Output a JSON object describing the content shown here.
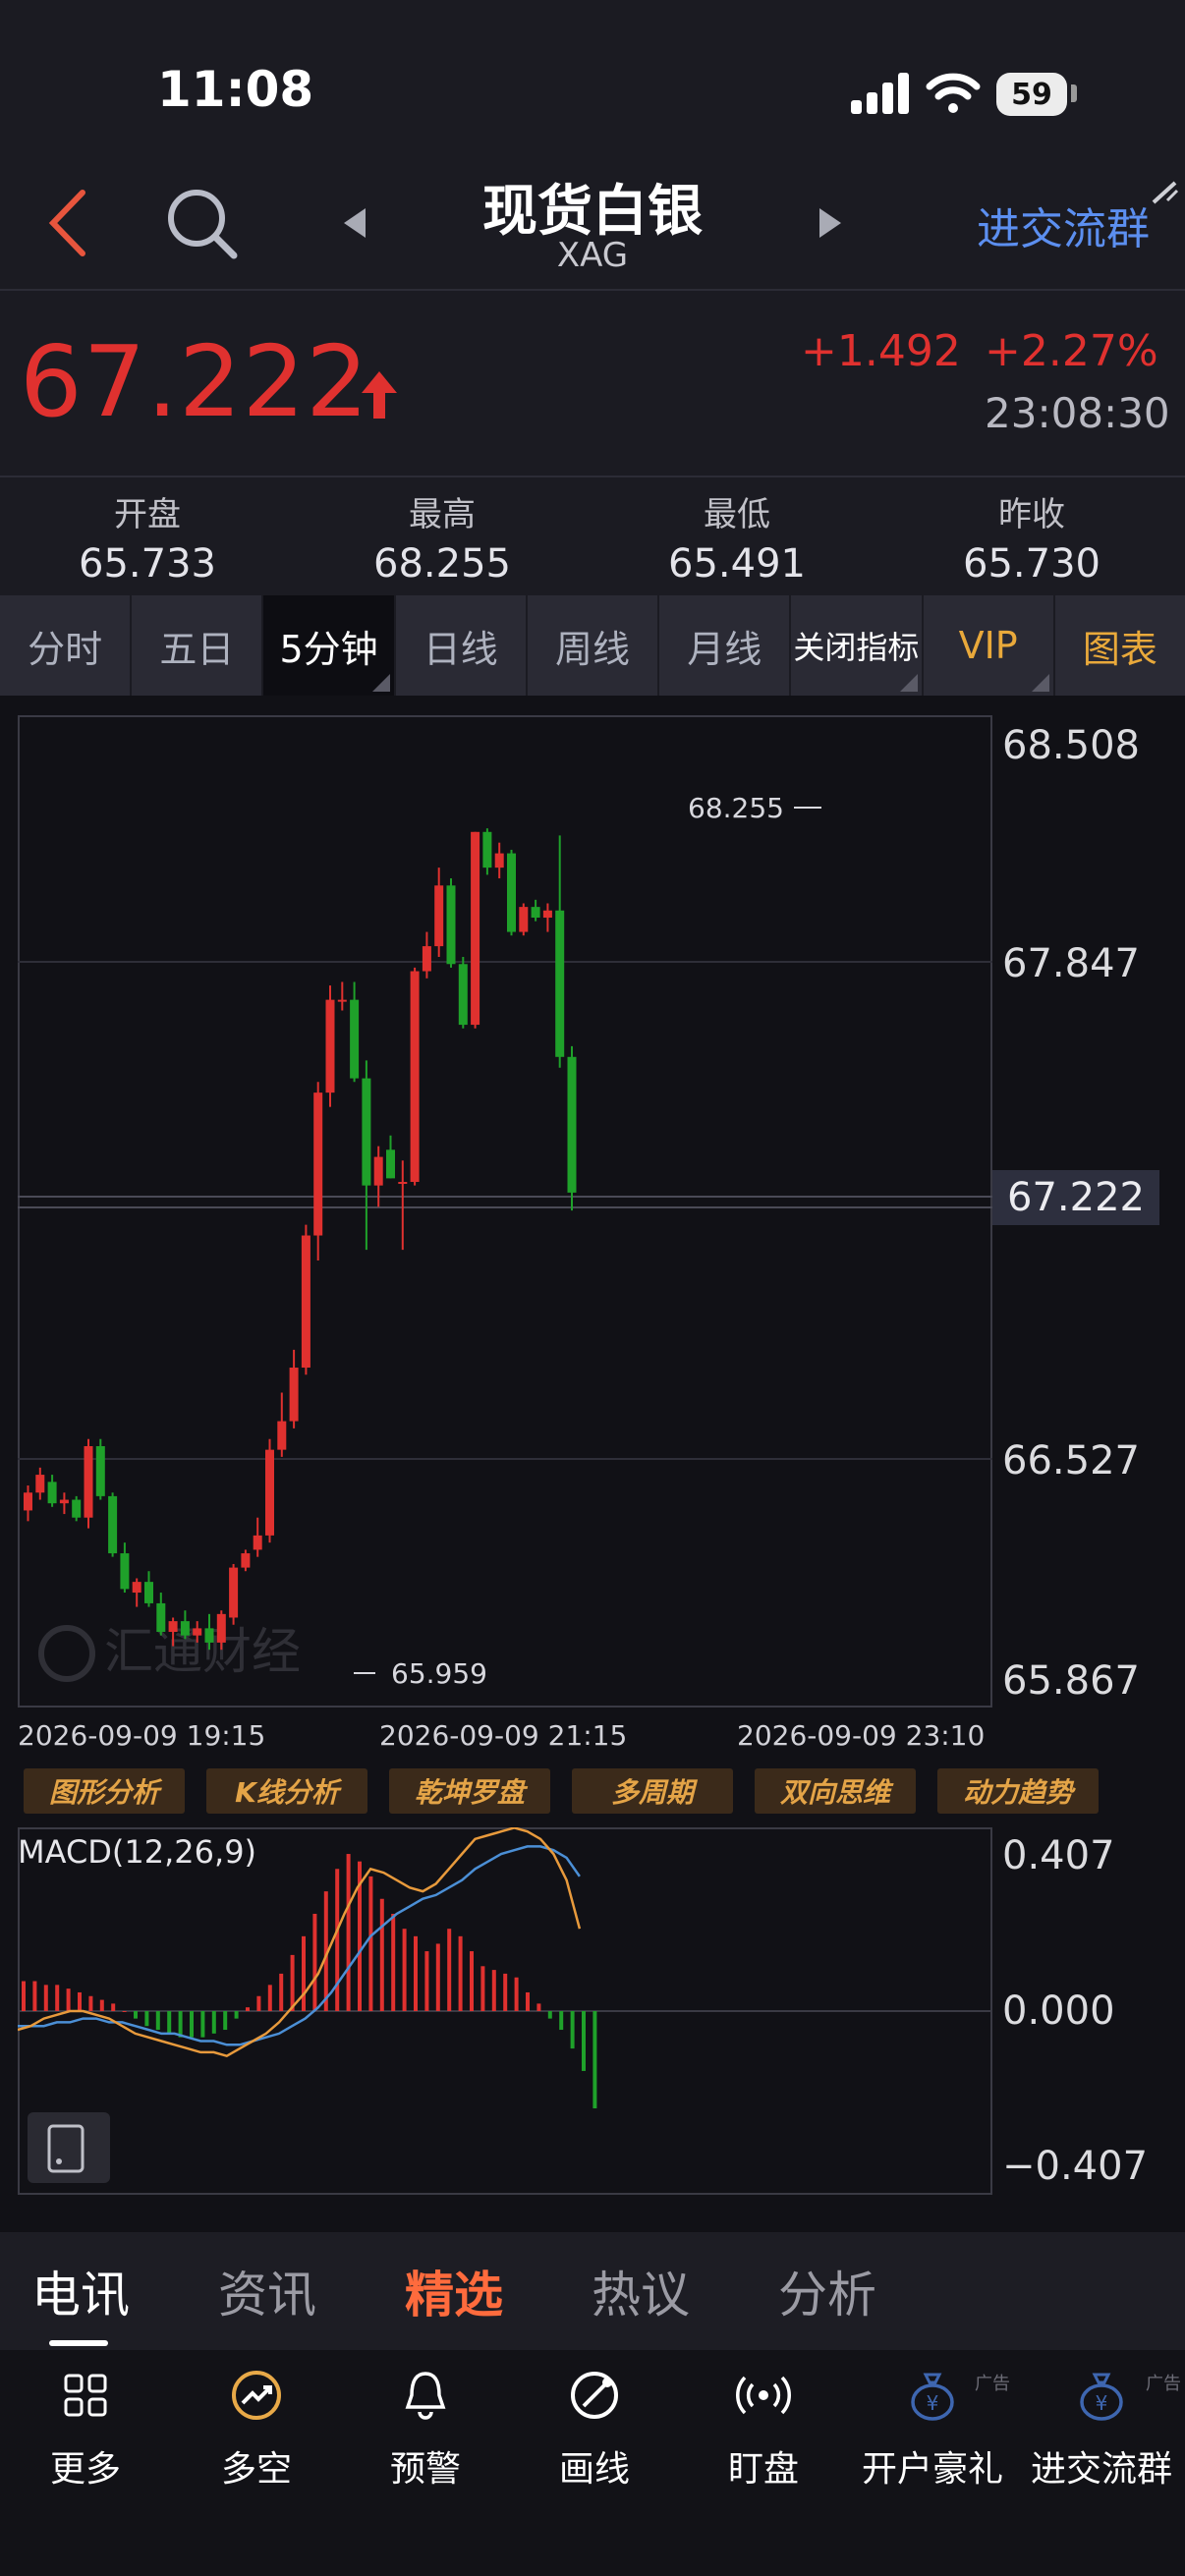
{
  "status_bar": {
    "time": "11:08",
    "battery": "59"
  },
  "header": {
    "title": "现货白银",
    "subtitle": "XAG",
    "join_group": "进交流群"
  },
  "quote": {
    "price": "67.222",
    "change_abs": "+1.492",
    "change_pct": "+2.27%",
    "time": "23:08:30",
    "stats": [
      {
        "label": "开盘",
        "value": "65.733"
      },
      {
        "label": "最高",
        "value": "68.255"
      },
      {
        "label": "最低",
        "value": "65.491"
      },
      {
        "label": "昨收",
        "value": "65.730"
      }
    ]
  },
  "period_tabs": [
    "分时",
    "五日",
    "5分钟",
    "日线",
    "周线",
    "月线",
    "关闭指标",
    "VIP",
    "图表"
  ],
  "chart_data": [
    {
      "type": "candlestick",
      "y_axis_labels": [
        "68.508",
        "67.847",
        "67.222",
        "66.527",
        "65.867"
      ],
      "ylim": [
        65.867,
        68.508
      ],
      "current_price": "67.222",
      "x_axis_labels": [
        "2026-09-09 19:15",
        "2026-09-09 21:15",
        "2026-09-09 23:10"
      ],
      "max_label": "68.255",
      "min_label": "65.959",
      "watermark": "汇通财经",
      "colors": {
        "up": "#e0312f",
        "down": "#1fa12a"
      },
      "candles": [
        [
          66.35,
          66.42,
          66.32,
          66.4
        ],
        [
          66.4,
          66.47,
          66.38,
          66.45
        ],
        [
          66.43,
          66.45,
          66.36,
          66.37
        ],
        [
          66.37,
          66.4,
          66.34,
          66.38
        ],
        [
          66.38,
          66.39,
          66.32,
          66.33
        ],
        [
          66.33,
          66.55,
          66.3,
          66.53
        ],
        [
          66.53,
          66.55,
          66.38,
          66.39
        ],
        [
          66.39,
          66.4,
          66.22,
          66.23
        ],
        [
          66.23,
          66.26,
          66.12,
          66.13
        ],
        [
          66.12,
          66.16,
          66.08,
          66.15
        ],
        [
          66.15,
          66.18,
          66.08,
          66.09
        ],
        [
          66.09,
          66.12,
          66.0,
          66.01
        ],
        [
          66.01,
          66.05,
          65.97,
          66.04
        ],
        [
          66.04,
          66.07,
          65.99,
          66.0
        ],
        [
          66.0,
          66.04,
          65.98,
          66.02
        ],
        [
          66.02,
          66.06,
          65.96,
          65.98
        ],
        [
          65.98,
          66.07,
          65.96,
          66.06
        ],
        [
          66.05,
          66.2,
          66.03,
          66.19
        ],
        [
          66.19,
          66.24,
          66.18,
          66.23
        ],
        [
          66.24,
          66.33,
          66.22,
          66.28
        ],
        [
          66.28,
          66.55,
          66.26,
          66.52
        ],
        [
          66.52,
          66.68,
          66.5,
          66.6
        ],
        [
          66.6,
          66.8,
          66.58,
          66.75
        ],
        [
          66.75,
          67.15,
          66.73,
          67.12
        ],
        [
          67.12,
          67.55,
          67.05,
          67.52
        ],
        [
          67.52,
          67.82,
          67.48,
          67.78
        ],
        [
          67.78,
          67.83,
          67.75,
          67.78
        ],
        [
          67.78,
          67.83,
          67.55,
          67.56
        ],
        [
          67.56,
          67.61,
          67.08,
          67.26
        ],
        [
          67.26,
          67.37,
          67.2,
          67.34
        ],
        [
          67.36,
          67.4,
          67.28,
          67.28
        ],
        [
          67.27,
          67.33,
          67.08,
          67.27
        ],
        [
          67.27,
          67.87,
          67.26,
          67.86
        ],
        [
          67.86,
          67.97,
          67.84,
          67.93
        ],
        [
          67.93,
          68.15,
          67.9,
          68.1
        ],
        [
          68.1,
          68.12,
          67.87,
          67.88
        ],
        [
          67.88,
          67.9,
          67.7,
          67.71
        ],
        [
          67.71,
          68.25,
          67.7,
          68.25
        ],
        [
          68.25,
          68.26,
          68.13,
          68.15
        ],
        [
          68.15,
          68.22,
          68.12,
          68.19
        ],
        [
          68.19,
          68.2,
          67.96,
          67.97
        ],
        [
          67.97,
          68.05,
          67.96,
          68.04
        ],
        [
          68.04,
          68.06,
          68.0,
          68.01
        ],
        [
          68.01,
          68.05,
          67.97,
          68.03
        ],
        [
          68.03,
          68.24,
          67.59,
          67.62
        ],
        [
          67.62,
          67.65,
          67.19,
          67.24
        ]
      ]
    },
    {
      "type": "macd",
      "title": "MACD(12,26,9)",
      "y_axis_labels": [
        "0.407",
        "0.000",
        "−0.407"
      ],
      "ylim": [
        -0.407,
        0.407
      ],
      "colors": {
        "dif": "#e89a3c",
        "dea": "#4b8fd6",
        "up": "#e0312f",
        "down": "#1fa12a"
      },
      "hist": [
        0.08,
        0.08,
        0.07,
        0.07,
        0.06,
        0.05,
        0.04,
        0.03,
        0.02,
        0.0,
        -0.02,
        -0.04,
        -0.05,
        -0.06,
        -0.07,
        -0.07,
        -0.07,
        -0.06,
        -0.05,
        -0.02,
        0.01,
        0.04,
        0.07,
        0.1,
        0.15,
        0.2,
        0.26,
        0.32,
        0.38,
        0.42,
        0.4,
        0.36,
        0.3,
        0.26,
        0.22,
        0.2,
        0.16,
        0.18,
        0.22,
        0.2,
        0.16,
        0.12,
        0.11,
        0.1,
        0.09,
        0.05,
        0.02,
        -0.02,
        -0.05,
        -0.1,
        -0.16,
        -0.26
      ],
      "dif": [
        -0.05,
        -0.04,
        -0.02,
        -0.01,
        0.0,
        0.0,
        -0.01,
        -0.02,
        -0.04,
        -0.06,
        -0.07,
        -0.08,
        -0.09,
        -0.1,
        -0.11,
        -0.11,
        -0.12,
        -0.1,
        -0.08,
        -0.06,
        -0.03,
        0.01,
        0.05,
        0.1,
        0.18,
        0.26,
        0.33,
        0.38,
        0.37,
        0.35,
        0.33,
        0.32,
        0.34,
        0.38,
        0.42,
        0.46,
        0.47,
        0.48,
        0.49,
        0.48,
        0.46,
        0.42,
        0.35,
        0.22
      ],
      "dea": [
        -0.04,
        -0.04,
        -0.04,
        -0.03,
        -0.03,
        -0.02,
        -0.02,
        -0.03,
        -0.03,
        -0.04,
        -0.05,
        -0.06,
        -0.06,
        -0.07,
        -0.08,
        -0.08,
        -0.09,
        -0.09,
        -0.08,
        -0.07,
        -0.06,
        -0.04,
        -0.02,
        0.01,
        0.05,
        0.1,
        0.15,
        0.2,
        0.23,
        0.26,
        0.28,
        0.3,
        0.31,
        0.33,
        0.35,
        0.38,
        0.4,
        0.42,
        0.43,
        0.44,
        0.44,
        0.43,
        0.41,
        0.36
      ]
    }
  ],
  "tool_buttons": [
    "图形分析",
    "K线分析",
    "乾坤罗盘",
    "多周期",
    "双向思维",
    "动力趋势"
  ],
  "news_tabs": [
    "电讯",
    "资讯",
    "精选",
    "热议",
    "分析"
  ],
  "bottom_tools": [
    {
      "label": "更多",
      "icon": "grid-icon"
    },
    {
      "label": "多空",
      "icon": "trend-icon"
    },
    {
      "label": "预警",
      "icon": "bell-icon"
    },
    {
      "label": "画线",
      "icon": "draw-icon"
    },
    {
      "label": "盯盘",
      "icon": "broadcast-icon"
    },
    {
      "label": "开户豪礼",
      "icon": "money-bag-icon",
      "ad": "广告"
    },
    {
      "label": "进交流群",
      "icon": "money-bag-icon",
      "ad": "广告"
    }
  ]
}
